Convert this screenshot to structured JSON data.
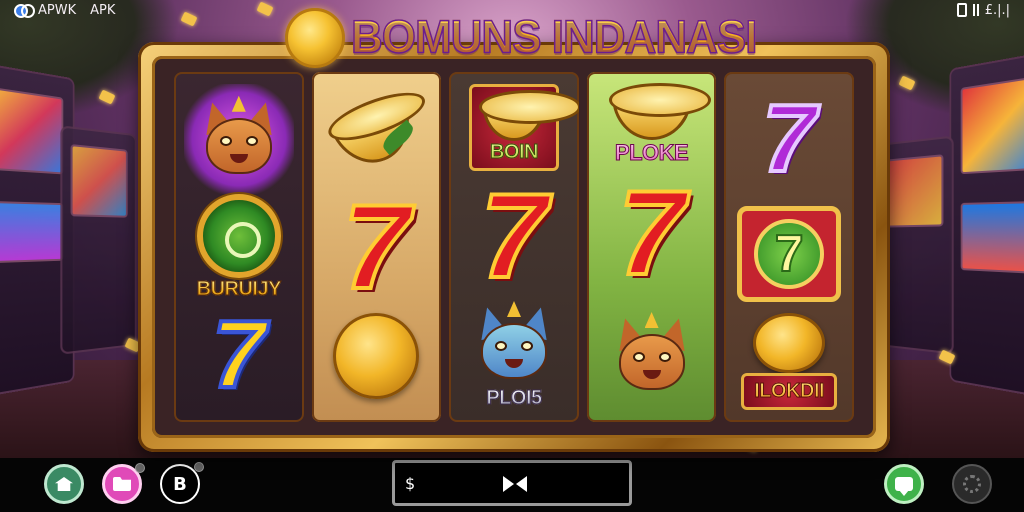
{
  "statusbar": {
    "brand": "APWK",
    "apk": "APK",
    "right_text": "£.|.|"
  },
  "title": "BOMUNS INDANASI",
  "reels": {
    "r1": {
      "row2_label": "BURUIJY"
    },
    "r3": {
      "row1_label": "BOIN",
      "row3_label": "PLOI5"
    },
    "r4": {
      "row1_label": "PLOKE"
    },
    "r5": {
      "row3_label": "ILOKDII"
    }
  },
  "symbols": {
    "seven": "7",
    "small_seven": "7"
  },
  "bottombar": {
    "logo_text": "B",
    "bet_currency": "$"
  },
  "colors": {
    "frame_gold": "#d9a23a",
    "title_stroke": "#6b1e8f",
    "seven_red": "#e21d22",
    "bottom_bar": "#050505"
  },
  "icons": [
    "brand-icon",
    "home-icon",
    "folder-icon",
    "logo-icon",
    "chat-icon",
    "settings-icon",
    "bowtie-icon",
    "phone-icon",
    "bars-icon"
  ]
}
